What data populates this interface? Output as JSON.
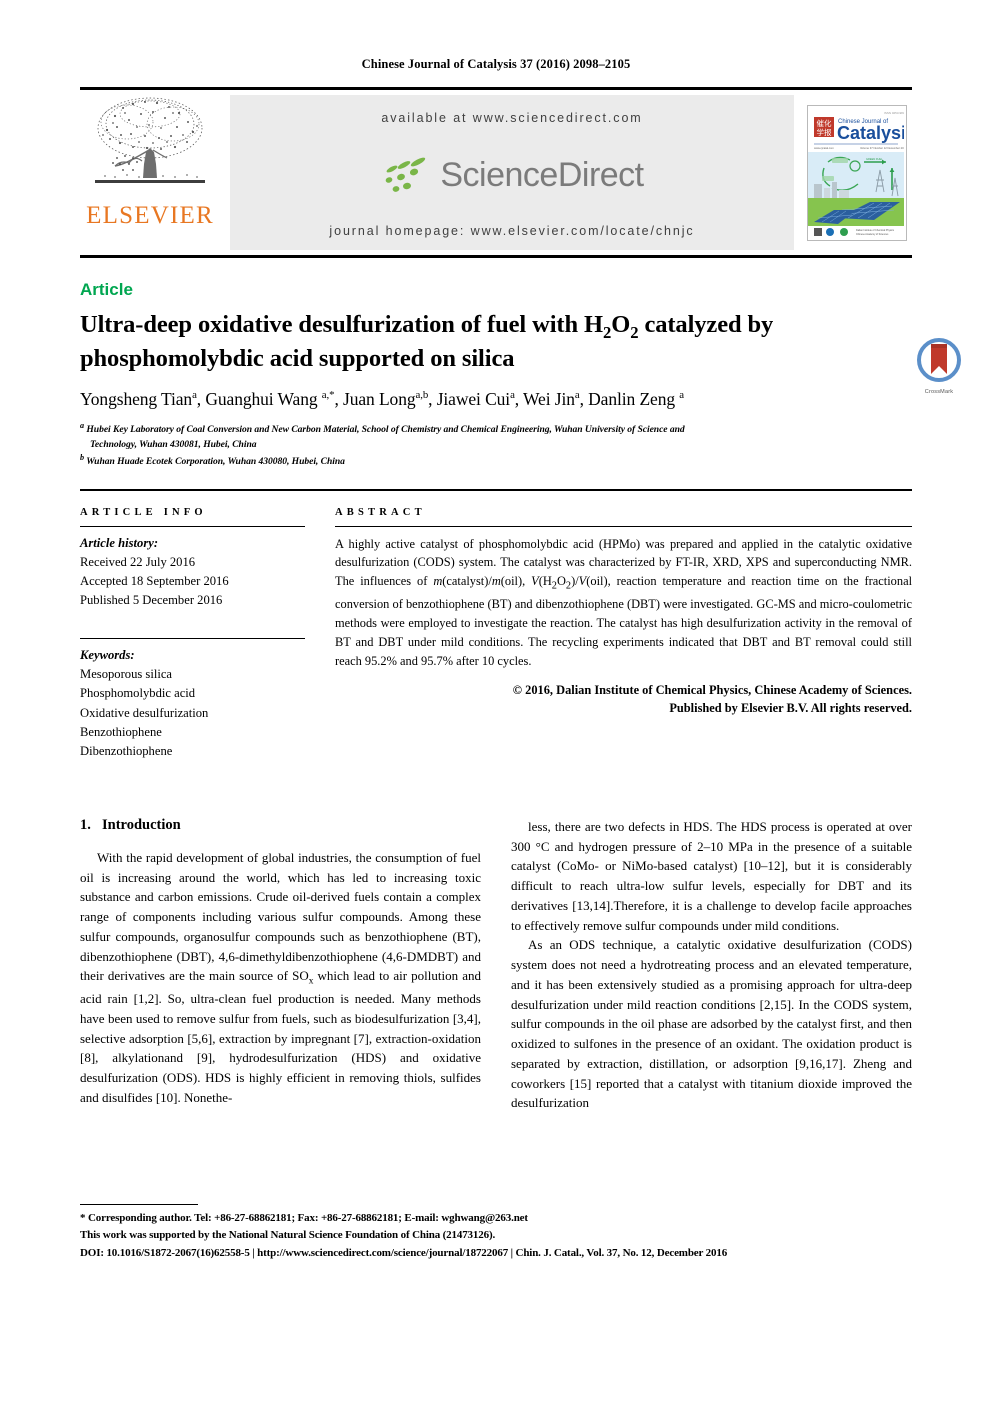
{
  "running_head": "Chinese Journal of Catalysis 37 (2016) 2098–2105",
  "masthead": {
    "publisher_name": "ELSEVIER",
    "available_at": "available at www.sciencedirect.com",
    "sciencedirect_wordmark": "ScienceDirect",
    "journal_homepage": "journal homepage: www.elsevier.com/locate/chnjc",
    "cover_title_cn": "催化学报",
    "cover_title_small": "Chinese Journal of",
    "cover_title_main": "Catalysis",
    "cover_issue_line": "Volume 37  Number 12  December 2016"
  },
  "article": {
    "type_label": "Article",
    "title_line1": "Ultra-deep oxidative desulfurization of fuel with H",
    "title_sub1": "2",
    "title_mid": "O",
    "title_sub2": "2",
    "title_line1_end": " catalyzed by",
    "title_line2": "phosphomolybdic acid supported on silica",
    "crossmark_label": "CrossMark",
    "authors_html": "Yongsheng Tian <sup>a</sup>, Guanghui Wang <sup>a,*</sup>, Juan Long <sup>a,b</sup>, Jiawei Cui <sup>a</sup>, Wei Jin <sup>a</sup>, Danlin Zeng <sup>a</sup>",
    "affiliation_a": "Hubei Key Laboratory of Coal Conversion and New Carbon Material, School of Chemistry and Chemical Engineering, Wuhan University of Science and",
    "affiliation_a_cont": "Technology, Wuhan 430081, Hubei, China",
    "affiliation_b": "Wuhan Huade Ecotek Corporation, Wuhan 430080, Hubei, China"
  },
  "info": {
    "heading": "ARTICLE INFO",
    "history_label": "Article history:",
    "received": "Received 22 July 2016",
    "accepted": "Accepted 18 September 2016",
    "published": "Published 5 December 2016",
    "keywords_label": "Keywords:",
    "keywords": [
      "Mesoporous silica",
      "Phosphomolybdic acid",
      "Oxidative desulfurization",
      "Benzothiophene",
      "Dibenzothiophene"
    ]
  },
  "abstract": {
    "heading": "ABSTRACT",
    "text_html": "A highly active catalyst of phosphomolybdic acid (HPMo) was prepared and applied in the catalytic oxidative desulfurization (CODS) system. The catalyst was characterized by FT-IR, XRD, XPS and superconducting NMR. The influences of <i>m</i>(catalyst)/<i>m</i>(oil), <i>V</i>(H<sub>2</sub>O<sub>2</sub>)/<i>V</i>(oil), reaction temperature and reaction time on the fractional conversion of benzothiophene (BT) and dibenzothiophene (DBT) were investigated. GC-MS and micro-coulometric methods were employed to investigate the reaction. The catalyst has high desulfurization activity in the removal of BT and DBT under mild conditions. The recycling experiments indicated that DBT and BT removal could still reach 95.2% and 95.7% after 10 cycles.",
    "copyright_line1": "© 2016, Dalian Institute of Chemical Physics, Chinese Academy of Sciences.",
    "copyright_line2": "Published by Elsevier B.V. All rights reserved."
  },
  "body": {
    "section_number": "1.",
    "section_title": "Introduction",
    "left_paragraph": "With the rapid development of global industries, the consumption of fuel oil is increasing around the world, which has led to increasing toxic substance and carbon emissions. Crude oil-derived fuels contain a complex range of components including various sulfur compounds. Among these sulfur compounds, organosulfur compounds such as benzothiophene (BT), dibenzothiophene (DBT), 4,6-dimethyldibenzothiophene (4,6-DMDBT) and their derivatives are the main source of SO<sub>x</sub> which lead to air pollution and acid rain [1,2]. So, ultra-clean fuel production is needed. Many methods have been used to remove sulfur from fuels, such as biodesulfurization [3,4], selective adsorption [5,6], extraction by impregnant [7], extraction-oxidation [8], alkylationand [9], hydrodesulfurization (HDS) and oxidative desulfurization (ODS). HDS is highly efficient in removing thiols, sulfides and disulfides [10]. Nonethe-",
    "right_paragraph_1": "less, there are two defects in HDS. The HDS process is operated at over 300 °C and hydrogen pressure of 2–10 MPa in the presence of a suitable catalyst (CoMo- or NiMo-based catalyst) [10–12], but it is considerably difficult to reach ultra-low sulfur levels, especially for DBT and its derivatives [13,14].Therefore, it is a challenge to develop facile approaches to effectively remove sulfur compounds under mild conditions.",
    "right_paragraph_2": "As an ODS technique, a catalytic oxidative desulfurization (CODS) system does not need a hydrotreating process and an elevated temperature, and it has been extensively studied as a promising approach for ultra-deep desulfurization under mild reaction conditions [2,15]. In the CODS system, sulfur compounds in the oil phase are adsorbed by the catalyst first, and then oxidized to sulfones in the presence of an oxidant. The oxidation product is separated by extraction, distillation, or adsorption [9,16,17]. Zheng and coworkers [15] reported that a catalyst with titanium dioxide improved the desulfurization"
  },
  "footnotes": {
    "corresponding": "* Corresponding author. Tel: +86-27-68862181; Fax: +86-27-68862181; E-mail: wghwang@263.net",
    "funding": "This work was supported by the National Natural Science Foundation of China (21473126).",
    "doi_line": "DOI: 10.1016/S1872-2067(16)62558-5 | http://www.sciencedirect.com/science/journal/18722067 | Chin. J. Catal., Vol. 37, No. 12, December 2016"
  },
  "colors": {
    "elsevier_orange": "#E87722",
    "article_green": "#00a650",
    "sciencedirect_green": "#7ab648",
    "sciencedirect_gray": "#7b7b7b",
    "banner_bg": "#ebebeb",
    "crossmark_red": "#c0392b",
    "crossmark_blue": "#5b8fc9"
  }
}
